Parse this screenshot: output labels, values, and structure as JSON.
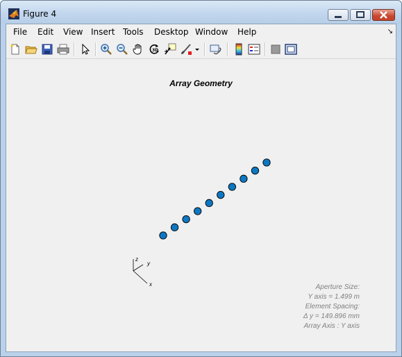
{
  "window": {
    "title": "Figure 4"
  },
  "menu": {
    "items": [
      "File",
      "Edit",
      "View",
      "Insert",
      "Tools",
      "Desktop",
      "Window",
      "Help"
    ]
  },
  "toolbar": {
    "icons": [
      "new-figure-icon",
      "open-file-icon",
      "save-icon",
      "print-icon",
      "edit-plot-pointer-icon",
      "zoom-in-icon",
      "zoom-out-icon",
      "pan-hand-icon",
      "rotate-3d-icon",
      "data-cursor-icon",
      "brush-icon",
      "brush-dropdown-icon",
      "link-plot-icon",
      "colorbar-icon",
      "legend-icon",
      "hide-plot-tools-icon",
      "show-plot-tools-icon"
    ]
  },
  "plot": {
    "title": "Array Geometry",
    "element_color": "#0f77c1",
    "element_count": 10,
    "axis_labels": {
      "z": "z",
      "y": "y",
      "x": "x"
    }
  },
  "info": {
    "line1": "Aperture Size:",
    "line2": "Y axis = 1.499 m",
    "line3": "Element Spacing:",
    "line4": "Δ y = 149.896 mm",
    "line5": "Array Axis : Y axis"
  }
}
